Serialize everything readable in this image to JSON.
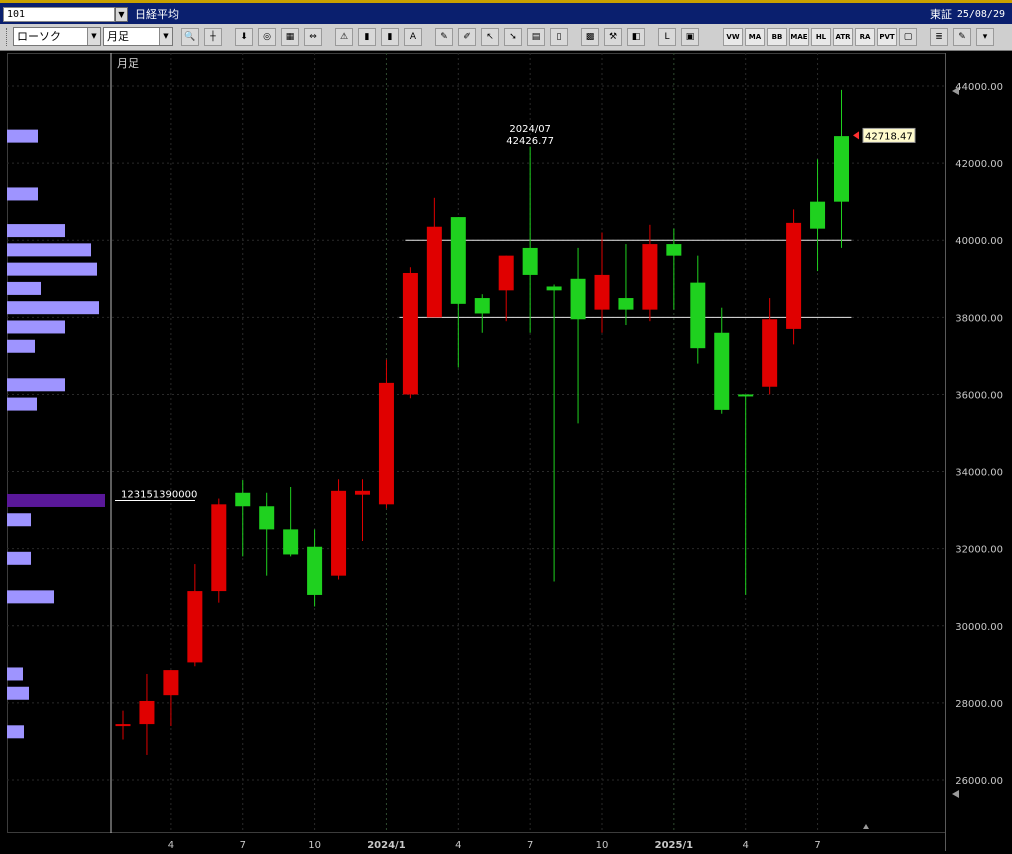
{
  "title_bar": {
    "code": "101",
    "instrument": "日経平均",
    "exchange": "東証",
    "date": "25/08/29"
  },
  "toolbar": {
    "chart_type": "ローソク",
    "period": "月足",
    "tools_left": [
      "search-icon",
      "crosshair-icon",
      "download-icon",
      "zoom-icon",
      "table-icon",
      "arrows-icon",
      "warning-icon",
      "candle-icon",
      "candle-icon",
      "all-icon",
      "pen-icon",
      "pencil-icon",
      "cursor-icon",
      "arrow-icon",
      "clipboard-icon",
      "trash-icon",
      "pattern-icon",
      "wrench-icon",
      "palette-icon",
      "log-icon",
      "calendar-icon"
    ],
    "text_buttons": [
      "VW AP",
      "MA",
      "BB",
      "MAE",
      "HL",
      "ATR",
      "RA RA",
      "PVT"
    ],
    "tools_right": [
      "window-icon",
      "list-icon",
      "edit-icon",
      "menu-icon"
    ]
  },
  "chart_data": {
    "type": "candlestick",
    "period_label": "月足",
    "y_axis": {
      "min": 24700,
      "max": 44600,
      "ticks": [
        "44000.00",
        "42000.00",
        "40000.00",
        "38000.00",
        "36000.00",
        "34000.00",
        "32000.00",
        "30000.00",
        "28000.00",
        "26000.00"
      ]
    },
    "x_labels": [
      {
        "label": "4",
        "index": 2
      },
      {
        "label": "7",
        "index": 5
      },
      {
        "label": "10",
        "index": 8
      },
      {
        "label": "2024/1",
        "index": 11
      },
      {
        "label": "4",
        "index": 14
      },
      {
        "label": "7",
        "index": 17
      },
      {
        "label": "10",
        "index": 20
      },
      {
        "label": "2025/1",
        "index": 23
      },
      {
        "label": "4",
        "index": 26
      },
      {
        "label": "7",
        "index": 29
      }
    ],
    "candles": [
      {
        "o": 27450,
        "h": 27800,
        "l": 27050,
        "c": 27450
      },
      {
        "o": 27450,
        "h": 28750,
        "l": 26650,
        "c": 28050
      },
      {
        "o": 28200,
        "h": 28850,
        "l": 27400,
        "c": 28850
      },
      {
        "o": 29050,
        "h": 31600,
        "l": 28950,
        "c": 30900
      },
      {
        "o": 30900,
        "h": 33300,
        "l": 30600,
        "c": 33150
      },
      {
        "o": 33450,
        "h": 33780,
        "l": 31800,
        "c": 33100
      },
      {
        "o": 33100,
        "h": 33450,
        "l": 31300,
        "c": 32500
      },
      {
        "o": 32500,
        "h": 33600,
        "l": 31800,
        "c": 31850
      },
      {
        "o": 32050,
        "h": 32500,
        "l": 30500,
        "c": 30800
      },
      {
        "o": 31300,
        "h": 33800,
        "l": 31200,
        "c": 33500
      },
      {
        "o": 33400,
        "h": 33800,
        "l": 32200,
        "c": 33500
      },
      {
        "o": 33150,
        "h": 36900,
        "l": 33050,
        "c": 36300
      },
      {
        "o": 36000,
        "h": 39300,
        "l": 35900,
        "c": 39150
      },
      {
        "o": 38000,
        "h": 41100,
        "l": 38300,
        "c": 40350
      },
      {
        "o": 40600,
        "h": 40600,
        "l": 36700,
        "c": 38350
      },
      {
        "o": 38500,
        "h": 38600,
        "l": 37600,
        "c": 38100
      },
      {
        "o": 38700,
        "h": 39600,
        "l": 37900,
        "c": 39600
      },
      {
        "o": 39800,
        "h": 42426.77,
        "l": 37600,
        "c": 39100
      },
      {
        "o": 38800,
        "h": 38850,
        "l": 31150,
        "c": 38700
      },
      {
        "o": 39000,
        "h": 39800,
        "l": 35250,
        "c": 37950
      },
      {
        "o": 38200,
        "h": 40200,
        "l": 37600,
        "c": 39100
      },
      {
        "o": 38500,
        "h": 39900,
        "l": 37800,
        "c": 38200
      },
      {
        "o": 38200,
        "h": 40400,
        "l": 37900,
        "c": 39900
      },
      {
        "o": 39900,
        "h": 40300,
        "l": 38200,
        "c": 39600
      },
      {
        "o": 38900,
        "h": 39600,
        "l": 36800,
        "c": 37200
      },
      {
        "o": 37600,
        "h": 38250,
        "l": 35500,
        "c": 35600
      },
      {
        "o": 36000,
        "h": 36000,
        "l": 30800,
        "c": 35950
      },
      {
        "o": 36200,
        "h": 38500,
        "l": 36000,
        "c": 37950
      },
      {
        "o": 37700,
        "h": 40800,
        "l": 37300,
        "c": 40450
      },
      {
        "o": 41000,
        "h": 42100,
        "l": 39200,
        "c": 40300
      },
      {
        "o": 42700,
        "h": 43900,
        "l": 39800,
        "c": 41000
      }
    ],
    "annotations": {
      "high_label_date": "2024/07",
      "high_label_value": "42426.77",
      "current_price": "42718.47",
      "volume_profile_label": "123151390000"
    },
    "horizontal_lines": [
      40000,
      38000
    ],
    "volume_profile_bins": [
      {
        "price": 42700,
        "w": 0.32
      },
      {
        "price": 41200,
        "w": 0.32
      },
      {
        "price": 40250,
        "w": 0.59
      },
      {
        "price": 39750,
        "w": 0.86
      },
      {
        "price": 39250,
        "w": 0.92
      },
      {
        "price": 38750,
        "w": 0.35
      },
      {
        "price": 38250,
        "w": 0.94
      },
      {
        "price": 37750,
        "w": 0.59
      },
      {
        "price": 37250,
        "w": 0.29
      },
      {
        "price": 36250,
        "w": 0.59
      },
      {
        "price": 35750,
        "w": 0.31
      },
      {
        "price": 33250,
        "w": 1.0
      },
      {
        "price": 32750,
        "w": 0.24
      },
      {
        "price": 31750,
        "w": 0.24
      },
      {
        "price": 30750,
        "w": 0.48
      },
      {
        "price": 28750,
        "w": 0.16
      },
      {
        "price": 28250,
        "w": 0.22
      },
      {
        "price": 27250,
        "w": 0.17
      }
    ],
    "colors": {
      "up": "#e00000",
      "down": "#1fd11f",
      "profile": "#9e94ff",
      "profile_highlight": "#5a189a",
      "grid": "#2a2a2a",
      "axis_text": "#c8c8c8"
    }
  }
}
